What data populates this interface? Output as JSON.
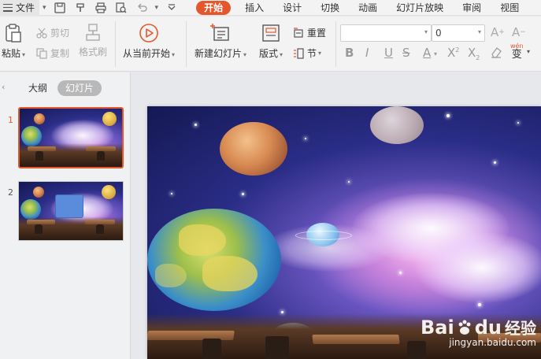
{
  "menubar": {
    "file_label": "文件",
    "tabs": [
      "开始",
      "插入",
      "设计",
      "切换",
      "动画",
      "幻灯片放映",
      "审阅",
      "视图"
    ],
    "active_tab": "开始"
  },
  "ribbon": {
    "paste": "粘贴",
    "cut": "剪切",
    "copy": "复制",
    "format_painter": "格式刷",
    "play_from_current": "从当前开始",
    "new_slide": "新建幻灯片",
    "layout": "版式",
    "reset": "重置",
    "section": "节",
    "font_name_value": "",
    "font_size_value": "0",
    "wen_label": "wén",
    "wen_char": "变"
  },
  "left_panel": {
    "outline_tab": "大纲",
    "slides_tab": "幻灯片",
    "slides": [
      {
        "number": "1",
        "selected": true
      },
      {
        "number": "2",
        "selected": false
      }
    ]
  },
  "watermark": {
    "brand": "Bai",
    "brand2": "du",
    "brand_cn": "经验",
    "url": "jingyan.baidu.com"
  },
  "colors": {
    "accent": "#e4572e",
    "ribbon_bg": "#f3f3f3",
    "panel_bg": "#f0f1f3",
    "canvas_bg": "#e7e8eb"
  }
}
